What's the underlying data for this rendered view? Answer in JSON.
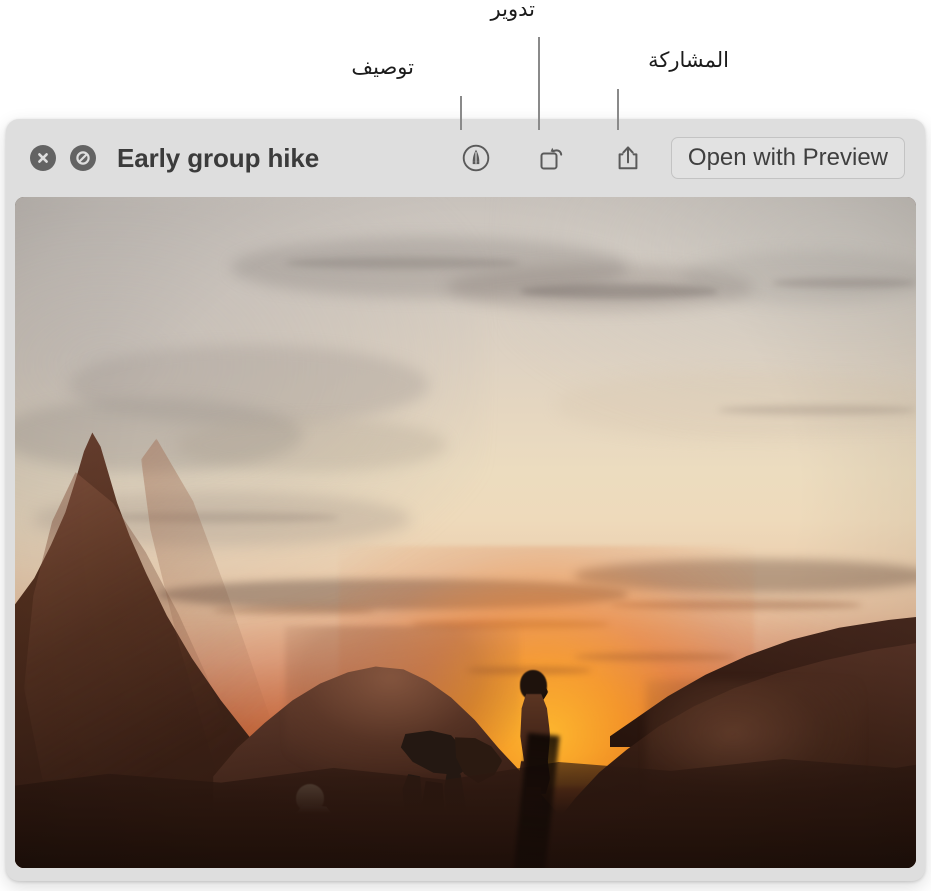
{
  "window": {
    "title": "Early group hike",
    "close_icon": "close-icon",
    "mute_icon": "no-entry-slash-icon"
  },
  "toolbar": {
    "markup_icon": "markup-pen-icon",
    "rotate_icon": "rotate-icon",
    "share_icon": "share-icon",
    "open_with_label": "Open with Preview"
  },
  "callouts": [
    {
      "label": "توصيف",
      "target": "markup-button"
    },
    {
      "label": "تدوير",
      "target": "rotate-button"
    },
    {
      "label": "المشاركة",
      "target": "share-button"
    }
  ],
  "photo": {
    "alt": "Three hikers silhouetted on red sandstone rocks at sunset"
  },
  "colors": {
    "window_bg": "#dedede",
    "toolbar_text": "#3b3b3b",
    "button_text": "#3f3f3f",
    "circle_button": "#636363",
    "callout_line": "#8a8a8a",
    "callout_text": "#1b1b1b"
  }
}
